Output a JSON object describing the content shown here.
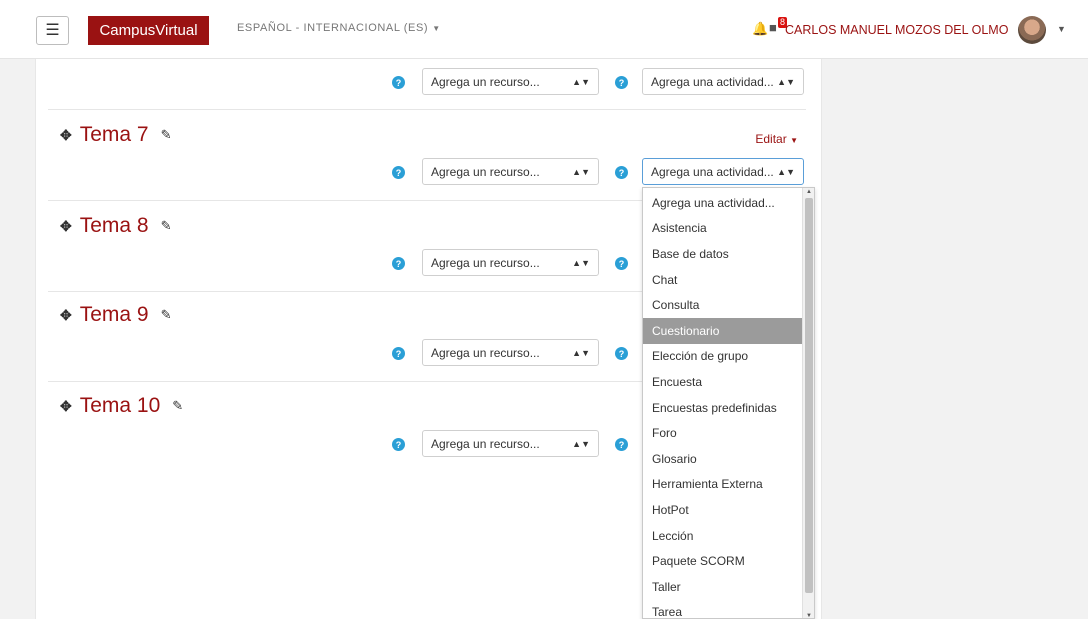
{
  "navbar": {
    "menu_icon": "hamburger-icon",
    "brand": "CampusVirtual",
    "language": "ESPAÑOL - INTERNACIONAL (ES)",
    "notifications_icon": "bell-icon",
    "messages_icon": "chat-bubble-icon",
    "messages_count": "8",
    "username": "CARLOS MANUEL MOZOS DEL OLMO"
  },
  "colors": {
    "brand": "#9a1212",
    "link": "#9a1212",
    "help": "#2a9fd6",
    "badge": "#d9120f"
  },
  "resource_placeholder": "Agrega un recurso...",
  "activity_placeholder": "Agrega una actividad...",
  "sections": [
    {
      "title": ""
    },
    {
      "title": "Tema 7",
      "edit_label": "Editar"
    },
    {
      "title": "Tema 8"
    },
    {
      "title": "Tema 9"
    },
    {
      "title": "Tema 10"
    }
  ],
  "activity_dropdown": {
    "selected": "Cuestionario",
    "options": [
      "Agrega una actividad...",
      "Asistencia",
      "Base de datos",
      "Chat",
      "Consulta",
      "Cuestionario",
      "Elección de grupo",
      "Encuesta",
      "Encuestas predefinidas",
      "Foro",
      "Glosario",
      "Herramienta Externa",
      "HotPot",
      "Lección",
      "Paquete SCORM",
      "Taller",
      "Tarea"
    ]
  }
}
